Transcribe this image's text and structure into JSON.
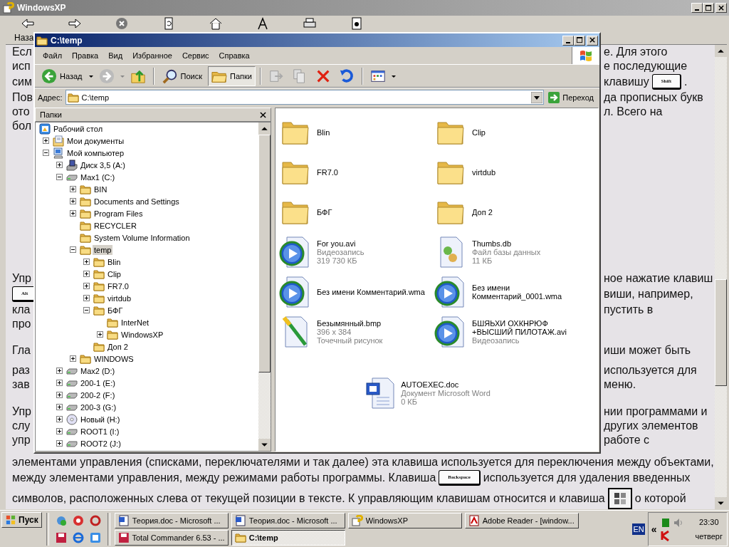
{
  "help_window": {
    "title": "WindowsXP",
    "back_label": "Наза",
    "document": [
      {
        "lines": [
          {
            "kind": "split",
            "left": [
              {
                "kind": "text",
                "text": "Есл"
              }
            ],
            "right": [
              {
                "kind": "text",
                "text": "е. Для этого"
              }
            ]
          },
          {
            "kind": "split",
            "left": [
              {
                "kind": "text",
                "text": "исп"
              }
            ],
            "right": [
              {
                "kind": "text",
                "text": "е последующие"
              }
            ]
          },
          {
            "kind": "split",
            "left": [
              {
                "kind": "text",
                "text": "сим"
              }
            ],
            "right": [
              {
                "kind": "text",
                "text": "клавишу"
              },
              {
                "kind": "key",
                "text": "Shift"
              },
              {
                "kind": "text",
                "text": "."
              }
            ]
          },
          {
            "kind": "split",
            "left": [
              {
                "kind": "text",
                "text": "Пов"
              }
            ],
            "right": [
              {
                "kind": "text",
                "text": "да прописных букв"
              }
            ]
          },
          {
            "kind": "split",
            "left": [
              {
                "kind": "text",
                "text": "ото"
              }
            ],
            "right": [
              {
                "kind": "text",
                "text": "л. Всего на"
              }
            ]
          },
          {
            "kind": "split",
            "left": [
              {
                "kind": "text",
                "text": "бол"
              }
            ]
          }
        ]
      },
      {
        "lines": [
          {
            "kind": "split",
            "left": [
              {
                "kind": "text",
                "text": "Упр"
              }
            ],
            "right": [
              {
                "kind": "text",
                "text": "ное нажатие клавиш"
              }
            ]
          },
          {
            "kind": "split",
            "left": [
              {
                "kind": "key",
                "text": "Alt"
              }
            ],
            "right": [
              {
                "kind": "text",
                "text": "виши, например,"
              }
            ]
          },
          {
            "kind": "split",
            "left": [
              {
                "kind": "text",
                "text": "кла"
              }
            ],
            "right": [
              {
                "kind": "text",
                "text": "пустить в"
              }
            ]
          },
          {
            "kind": "split",
            "left": [
              {
                "kind": "text",
                "text": "про"
              }
            ]
          }
        ]
      },
      {
        "lines": [
          {
            "kind": "split",
            "left": [
              {
                "kind": "text",
                "text": "Гла"
              }
            ],
            "right": [
              {
                "kind": "text",
                "text": "иши может быть"
              }
            ]
          }
        ]
      },
      {
        "lines": [
          {
            "kind": "split",
            "left": [
              {
                "kind": "text",
                "text": "раз"
              }
            ],
            "right": [
              {
                "kind": "text",
                "text": "используется для"
              }
            ]
          },
          {
            "kind": "split",
            "left": [
              {
                "kind": "text",
                "text": "зав"
              }
            ],
            "right": [
              {
                "kind": "text",
                "text": "меню."
              }
            ]
          }
        ]
      },
      {
        "lines": [
          {
            "kind": "split",
            "left": [
              {
                "kind": "text",
                "text": "Упр"
              }
            ],
            "right": [
              {
                "kind": "text",
                "text": "нии программами и"
              }
            ]
          },
          {
            "kind": "split",
            "left": [
              {
                "kind": "text",
                "text": "слу"
              }
            ],
            "right": [
              {
                "kind": "text",
                "text": "других элементов"
              }
            ]
          },
          {
            "kind": "split",
            "left": [
              {
                "kind": "text",
                "text": "упр"
              }
            ],
            "right": [
              {
                "kind": "text",
                "text": "работе с"
              }
            ]
          },
          {
            "kind": "full",
            "parts": [
              {
                "kind": "text",
                "text": "элементами управления (списками, переключателями и так далее) эта клавиша используется для переключения между объектами,"
              }
            ]
          },
          {
            "kind": "full",
            "parts": [
              {
                "kind": "text",
                "text": "между элементами управления, между режимами работы программы. Клавиша"
              },
              {
                "kind": "key",
                "text": "Backspace"
              },
              {
                "kind": "text",
                "text": "используется для удаления введенных"
              }
            ]
          }
        ]
      },
      {
        "lines": [
          {
            "kind": "full",
            "parts": [
              {
                "kind": "text",
                "text": "символов, расположенных слева от текущей позиции в тексте. К управляющим клавишам относится и клавиша"
              },
              {
                "kind": "winkey"
              },
              {
                "kind": "text",
                "text": "о которой"
              }
            ]
          }
        ]
      }
    ]
  },
  "explorer": {
    "title": "C:\\temp",
    "menu": [
      "Файл",
      "Правка",
      "Вид",
      "Избранное",
      "Сервис",
      "Справка"
    ],
    "back_label": "Назад",
    "toggles": [
      {
        "label": "Поиск",
        "pressed": false
      },
      {
        "label": "Папки",
        "pressed": true
      }
    ],
    "address": {
      "label": "Адрес:",
      "value": "C:\\temp",
      "go": "Переход"
    },
    "folders_title": "Папки",
    "tree": [
      {
        "label": "Рабочий стол",
        "kind": "desktop",
        "selected": false,
        "children": [
          {
            "label": "Мои документы",
            "kind": "documents",
            "expanded": false,
            "selected": false
          },
          {
            "label": "Мой компьютер",
            "kind": "computer",
            "expanded": true,
            "selected": false,
            "children": [
              {
                "label": "Диск 3,5 (A:)",
                "kind": "floppy",
                "expanded": false,
                "selected": false
              },
              {
                "label": "Max1 (C:)",
                "kind": "drive",
                "expanded": true,
                "selected": false,
                "children": [
                  {
                    "label": "BIN",
                    "kind": "folder",
                    "expanded": false,
                    "selected": false
                  },
                  {
                    "label": "Documents and Settings",
                    "kind": "folder",
                    "expanded": false,
                    "selected": false
                  },
                  {
                    "label": "Program Files",
                    "kind": "folder",
                    "expanded": false,
                    "selected": false
                  },
                  {
                    "label": "RECYCLER",
                    "kind": "folder",
                    "selected": false
                  },
                  {
                    "label": "System Volume Information",
                    "kind": "folder",
                    "selected": false
                  },
                  {
                    "label": "temp",
                    "kind": "folder",
                    "expanded": true,
                    "selected": true,
                    "children": [
                      {
                        "label": "Blin",
                        "kind": "folder",
                        "expanded": false,
                        "selected": false
                      },
                      {
                        "label": "Clip",
                        "kind": "folder",
                        "expanded": false,
                        "selected": false
                      },
                      {
                        "label": "FR7.0",
                        "kind": "folder",
                        "expanded": false,
                        "selected": false
                      },
                      {
                        "label": "virtdub",
                        "kind": "folder",
                        "expanded": false,
                        "selected": false
                      },
                      {
                        "label": "БФГ",
                        "kind": "folder",
                        "expanded": true,
                        "selected": false,
                        "children": [
                          {
                            "label": "InterNet",
                            "kind": "folder",
                            "selected": false
                          },
                          {
                            "label": "WindowsXP",
                            "kind": "folder",
                            "expanded": false,
                            "selected": false
                          }
                        ]
                      },
                      {
                        "label": "Доп 2",
                        "kind": "folder",
                        "selected": false
                      }
                    ]
                  },
                  {
                    "label": "WINDOWS",
                    "kind": "folder",
                    "expanded": false,
                    "selected": false
                  }
                ]
              },
              {
                "label": "Max2 (D:)",
                "kind": "drive",
                "expanded": false,
                "selected": false
              },
              {
                "label": "200-1 (E:)",
                "kind": "drive",
                "expanded": false,
                "selected": false
              },
              {
                "label": "200-2 (F:)",
                "kind": "drive",
                "expanded": false,
                "selected": false
              },
              {
                "label": "200-3 (G:)",
                "kind": "drive",
                "expanded": false,
                "selected": false
              },
              {
                "label": "Новый (H:)",
                "kind": "cd",
                "expanded": false,
                "selected": false
              },
              {
                "label": "ROOT1 (I:)",
                "kind": "drive",
                "expanded": false,
                "selected": false
              },
              {
                "label": "ROOT2 (J:)",
                "kind": "drive",
                "expanded": false,
                "selected": false
              }
            ]
          }
        ]
      }
    ],
    "files": [
      {
        "name": "Blin",
        "kind": "folder"
      },
      {
        "name": "Clip",
        "kind": "folder"
      },
      {
        "name": "FR7.0",
        "kind": "folder"
      },
      {
        "name": "virtdub",
        "kind": "folder"
      },
      {
        "name": "БФГ",
        "kind": "folder"
      },
      {
        "name": "Доп 2",
        "kind": "folder"
      },
      {
        "name": "For you.avi",
        "kind": "video",
        "details": [
          "Видеозапись",
          "319 730 КБ"
        ]
      },
      {
        "name": "Thumbs.db",
        "kind": "database",
        "details": [
          "Файл базы данных",
          "11 КБ"
        ]
      },
      {
        "name": "Без имени Комментарий.wma",
        "kind": "audio"
      },
      {
        "name": "Без имени Комментарий_0001.wma",
        "kind": "audio"
      },
      {
        "name": "Безымянный.bmp",
        "kind": "image",
        "details": [
          "396 x 384",
          "Точечный рисунок"
        ]
      },
      {
        "name": "БШЯЬХИ ОХКНРЮФ +ВЫСШИЙ ПИЛОТАЖ.avi",
        "kind": "video",
        "details": [
          "Видеозапись"
        ]
      },
      {
        "name": "AUTOEXEC.doc",
        "kind": "document",
        "details": [
          "Документ Microsoft Word",
          "0 КБ"
        ]
      }
    ]
  },
  "taskbar": {
    "start": "Пуск",
    "tasks": [
      {
        "label": "Теория.doc - Microsoft ...",
        "kind": "document",
        "selected": false
      },
      {
        "label": "Теория.doc - Microsoft ...",
        "kind": "document",
        "selected": false
      },
      {
        "label": "WindowsXP",
        "kind": "help",
        "selected": false
      },
      {
        "label": "Adobe Reader - [window...",
        "kind": "pdf",
        "selected": false
      },
      {
        "label": "Total Commander 6.53 - ...",
        "kind": "commander",
        "selected": false
      },
      {
        "label": "C:\\temp",
        "kind": "folder",
        "selected": true
      }
    ],
    "language": "EN",
    "chevron": "«",
    "time": "23:30",
    "day": "четверг"
  }
}
